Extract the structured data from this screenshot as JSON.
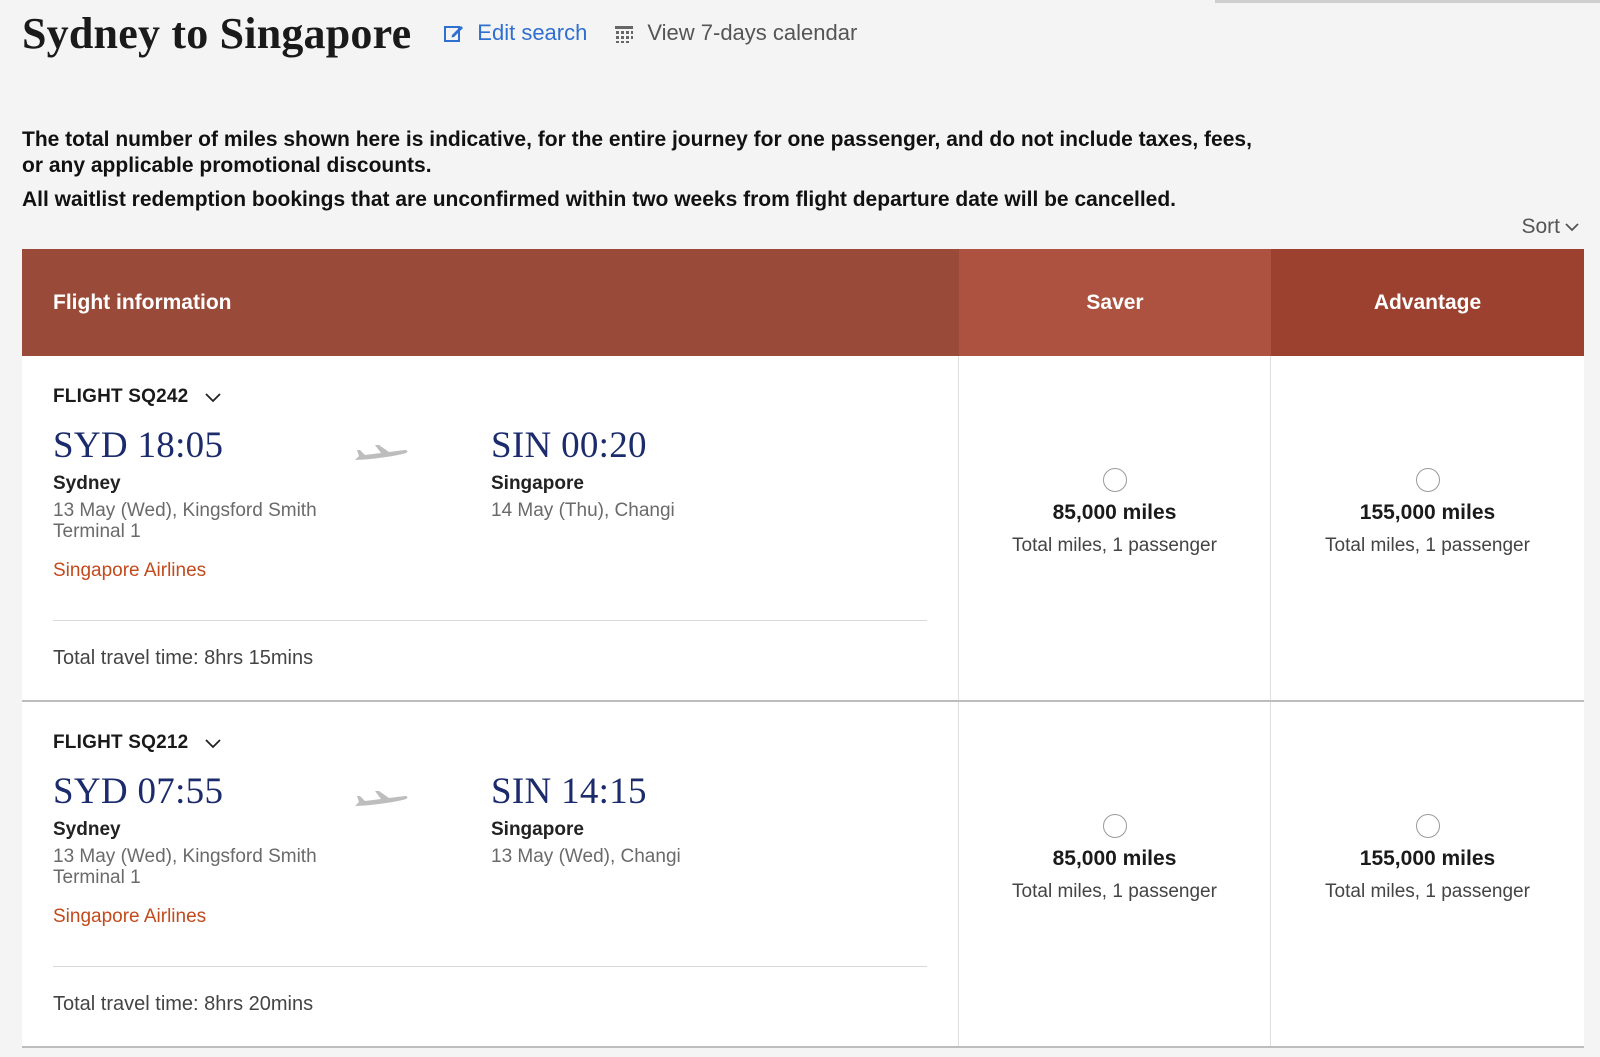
{
  "header": {
    "title": "Sydney to Singapore",
    "edit_search": "Edit search",
    "view_calendar": "View 7-days calendar"
  },
  "notices": {
    "miles_notice": "The total number of miles shown here is indicative, for the entire journey for one passenger, and do not include taxes, fees, or any applicable promotional discounts.",
    "waitlist_notice": "All waitlist redemption bookings that are unconfirmed within two weeks from flight departure date will be cancelled."
  },
  "sort_label": "Sort",
  "table": {
    "col_flight": "Flight information",
    "col_saver": "Saver",
    "col_advantage": "Advantage"
  },
  "flights": [
    {
      "flight_number": "FLIGHT SQ242",
      "dep_time": "SYD 18:05",
      "dep_city": "Sydney",
      "dep_detail": "13 May (Wed), Kingsford Smith Terminal 1",
      "arr_time": "SIN 00:20",
      "arr_city": "Singapore",
      "arr_detail": "14 May (Thu), Changi",
      "airline": "Singapore Airlines",
      "travel_time": "Total travel time: 8hrs 15mins",
      "saver_miles": "85,000 miles",
      "saver_sub": "Total miles, 1 passenger",
      "advantage_miles": "155,000 miles",
      "advantage_sub": "Total miles, 1 passenger"
    },
    {
      "flight_number": "FLIGHT SQ212",
      "dep_time": "SYD 07:55",
      "dep_city": "Sydney",
      "dep_detail": "13 May (Wed), Kingsford Smith Terminal 1",
      "arr_time": "SIN 14:15",
      "arr_city": "Singapore",
      "arr_detail": "13 May (Wed), Changi",
      "airline": "Singapore Airlines",
      "travel_time": "Total travel time: 8hrs 20mins",
      "saver_miles": "85,000 miles",
      "saver_sub": "Total miles, 1 passenger",
      "advantage_miles": "155,000 miles",
      "advantage_sub": "Total miles, 1 passenger"
    }
  ],
  "icons": {
    "edit": "edit-icon",
    "calendar": "calendar-icon",
    "chevron": "chevron-down-icon",
    "plane": "plane-icon"
  },
  "colors": {
    "header_dark": "#9a4a38",
    "header_saver": "#ad5240",
    "header_advantage": "#9c4130",
    "link_blue": "#2f6fd0",
    "airline_orange": "#c24a1c",
    "time_navy": "#1b2b6b"
  }
}
